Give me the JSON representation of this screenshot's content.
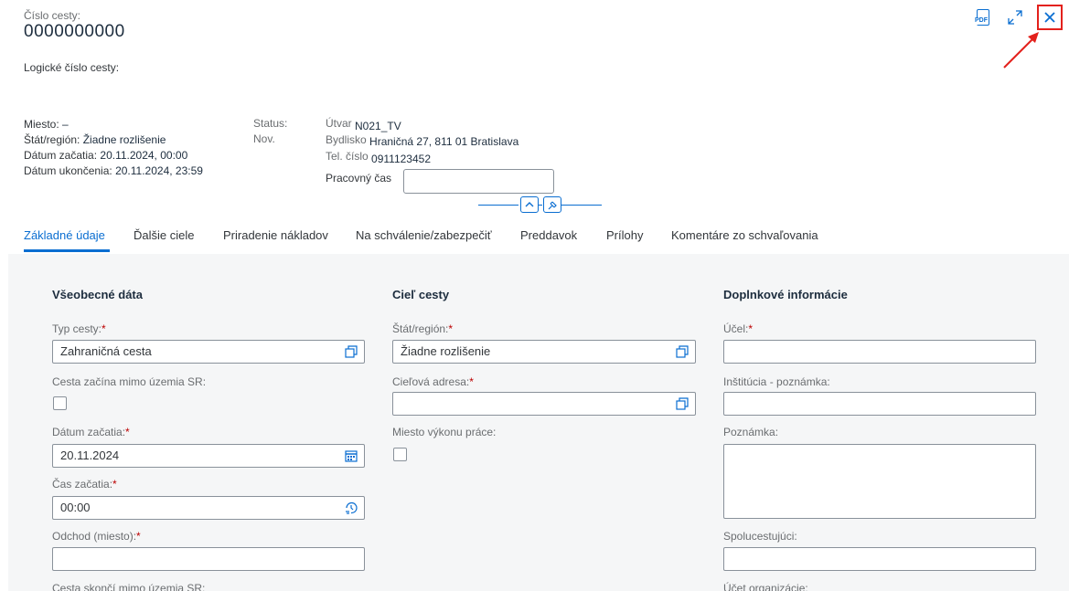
{
  "header": {
    "trip_number_label": "Číslo cesty:",
    "trip_number_value": "0000000000",
    "logical_trip_label": "Logické číslo cesty:"
  },
  "info_left": {
    "place_label": "Miesto:",
    "place_value": "–",
    "country_label": "Štát/región:",
    "country_value": "Žiadne rozlišenie",
    "start_label": "Dátum začatia:",
    "start_value": "20.11.2024, 00:00",
    "end_label": "Dátum ukončenia:",
    "end_value": "20.11.2024, 23:59"
  },
  "status": {
    "label": "Status:",
    "value": "Nov."
  },
  "info_right": {
    "unit_label": "Útvar",
    "unit_value": "N021_TV",
    "residence_label": "Bydlisko",
    "residence_value": "Hraničná 27, 811 01 Bratislava",
    "phone_label": "Tel. číslo",
    "phone_value": "0911123452",
    "worktime_label": "Pracovný čas",
    "worktime_value": ""
  },
  "toolbar": {
    "pdf_icon": "pdf-icon",
    "fullscreen_icon": "expand-icon",
    "close_icon": "close-icon",
    "pdf_text": "PDF"
  },
  "tabs": [
    {
      "label": "Základné údaje",
      "active": true
    },
    {
      "label": "Ďalšie ciele"
    },
    {
      "label": "Priradenie nákladov"
    },
    {
      "label": "Na schválenie/zabezpečiť"
    },
    {
      "label": "Preddavok"
    },
    {
      "label": "Prílohy"
    },
    {
      "label": "Komentáre zo schvaľovania"
    }
  ],
  "sections": {
    "general": {
      "title": "Všeobecné dáta",
      "trip_type_label": "Typ cesty:",
      "trip_type_value": "Zahraničná cesta",
      "starts_outside_label": "Cesta začína mimo územia SR:",
      "start_date_label": "Dátum začatia:",
      "start_date_value": "20.11.2024",
      "start_time_label": "Čas začatia:",
      "start_time_value": "00:00",
      "departure_label": "Odchod (miesto):",
      "departure_value": "",
      "ends_outside_label": "Cesta skončí mimo územia SR:"
    },
    "destination": {
      "title": "Cieľ cesty",
      "country_label": "Štát/región:",
      "country_value": "Žiadne rozlišenie",
      "address_label": "Cieľová adresa:",
      "address_value": "",
      "workplace_label": "Miesto výkonu práce:"
    },
    "additional": {
      "title": "Doplnkové informácie",
      "purpose_label": "Účel:",
      "purpose_value": "",
      "institution_label": "Inštitúcia - poznámka:",
      "institution_value": "",
      "note_label": "Poznámka:",
      "note_value": "",
      "companions_label": "Spolucestujúci:",
      "companions_value": "",
      "account_label": "Účet organizácie:"
    }
  },
  "required_mark": "*"
}
